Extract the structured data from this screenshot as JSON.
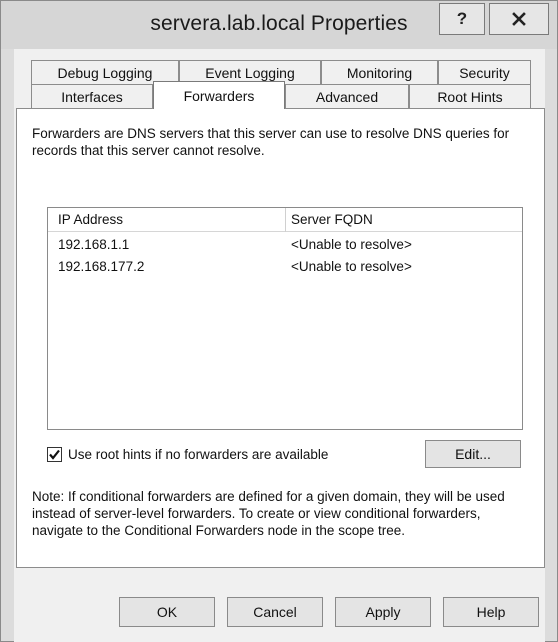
{
  "window": {
    "title": "servera.lab.local Properties",
    "help_label": "?",
    "close_icon": "close-icon"
  },
  "tabs": {
    "row1": [
      {
        "label": "Debug Logging"
      },
      {
        "label": "Event Logging"
      },
      {
        "label": "Monitoring"
      },
      {
        "label": "Security"
      }
    ],
    "row2": [
      {
        "label": "Interfaces"
      },
      {
        "label": "Forwarders",
        "active": true
      },
      {
        "label": "Advanced"
      },
      {
        "label": "Root Hints"
      }
    ]
  },
  "forwarders": {
    "description": "Forwarders are DNS servers that this server can use to resolve DNS queries for records that this server cannot resolve.",
    "columns": [
      "IP Address",
      "Server FQDN"
    ],
    "rows": [
      {
        "ip": "192.168.1.1",
        "fqdn": "<Unable to resolve>"
      },
      {
        "ip": "192.168.177.2",
        "fqdn": "<Unable to resolve>"
      }
    ],
    "use_root_hints_label": "Use root hints if no forwarders are available",
    "use_root_hints_checked": true,
    "edit_label": "Edit...",
    "note": "Note: If conditional forwarders are defined for a given domain, they will be used instead of server-level forwarders.  To create or view conditional forwarders, navigate to the Conditional Forwarders node in the scope tree."
  },
  "buttons": {
    "ok": "OK",
    "cancel": "Cancel",
    "apply": "Apply",
    "help": "Help"
  }
}
